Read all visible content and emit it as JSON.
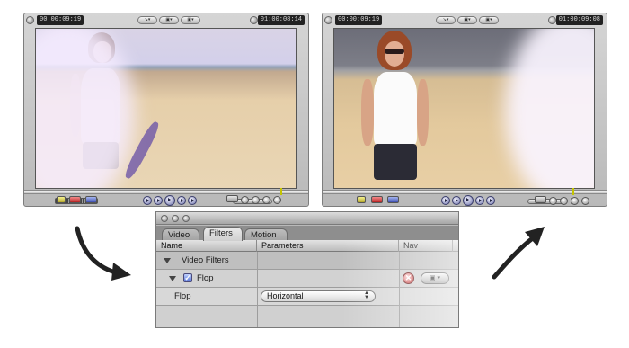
{
  "viewers": {
    "left": {
      "timecode_in": "00:00:09:19",
      "timecode_out": "01:00:08:14",
      "popup_zoom": "↘▾",
      "popup_view": "▣▾"
    },
    "right": {
      "timecode_in": "00:00:09:19",
      "timecode_out": "01:00:09:08",
      "popup_zoom": "↘▾",
      "popup_view": "▣▾"
    }
  },
  "filters_panel": {
    "tabs": [
      {
        "label": "Video",
        "active": false
      },
      {
        "label": "Filters",
        "active": true
      },
      {
        "label": "Motion",
        "active": false
      }
    ],
    "columns": {
      "name": "Name",
      "parameters": "Parameters",
      "nav": "Nav"
    },
    "group_label": "Video Filters",
    "filter": {
      "name": "Flop",
      "enabled": true
    },
    "parameter": {
      "name": "Flop",
      "value": "Horizontal"
    }
  },
  "icons": {
    "arrow_left": "curved-arrow-down-right-icon",
    "arrow_right": "curved-arrow-up-right-icon",
    "delete": "delete-filter-icon",
    "nav": "nav-menu-icon"
  },
  "colors": {
    "panel_bg": "#b9b9b9",
    "checkbox_blue": "#5573d6",
    "delete_red": "#b72323",
    "playhead": "#c4c400"
  }
}
